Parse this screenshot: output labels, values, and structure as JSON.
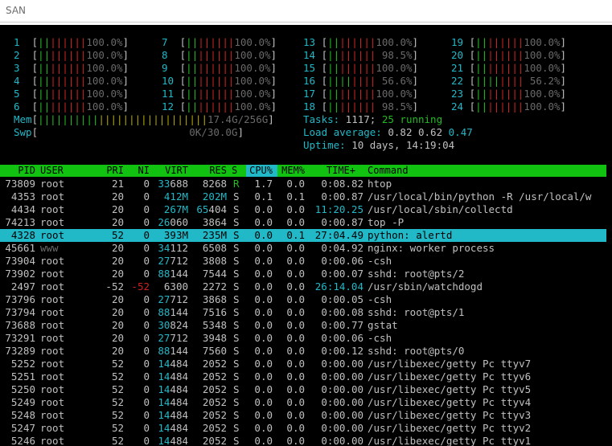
{
  "window": {
    "title": "SAN"
  },
  "cpus": [
    {
      "n": "1",
      "bars": "||||||||",
      "pct": "100.0%"
    },
    {
      "n": "2",
      "bars": "||||||||",
      "pct": "100.0%"
    },
    {
      "n": "3",
      "bars": "||||||||",
      "pct": "100.0%"
    },
    {
      "n": "4",
      "bars": "||||||||",
      "pct": "100.0%"
    },
    {
      "n": "5",
      "bars": "||||||||",
      "pct": "100.0%"
    },
    {
      "n": "6",
      "bars": "||||||||",
      "pct": "100.0%"
    },
    {
      "n": "7",
      "bars": "||||||||",
      "pct": "100.0%"
    },
    {
      "n": "8",
      "bars": "||||||||",
      "pct": "100.0%"
    },
    {
      "n": "9",
      "bars": "||||||||",
      "pct": "100.0%"
    },
    {
      "n": "10",
      "bars": "||||||||",
      "pct": "100.0%"
    },
    {
      "n": "11",
      "bars": "||||||||",
      "pct": "100.0%"
    },
    {
      "n": "12",
      "bars": "||||||||",
      "pct": "100.0%"
    },
    {
      "n": "13",
      "bars": "||||||||",
      "pct": "100.0%"
    },
    {
      "n": "14",
      "bars": "||||||||",
      "pct": "98.5%"
    },
    {
      "n": "15",
      "bars": "||||||||",
      "pct": "100.0%"
    },
    {
      "n": "16",
      "bars": "||||||||",
      "pct": "56.6%"
    },
    {
      "n": "17",
      "bars": "||||||||",
      "pct": "100.0%"
    },
    {
      "n": "18",
      "bars": "||||||||",
      "pct": "98.5%"
    },
    {
      "n": "19",
      "bars": "||||||||",
      "pct": "100.0%"
    },
    {
      "n": "20",
      "bars": "||||||||",
      "pct": "100.0%"
    },
    {
      "n": "21",
      "bars": "||||||||",
      "pct": "100.0%"
    },
    {
      "n": "22",
      "bars": "||||||||",
      "pct": "56.2%"
    },
    {
      "n": "23",
      "bars": "||||||||",
      "pct": "100.0%"
    },
    {
      "n": "24",
      "bars": "||||||||",
      "pct": "100.0%"
    }
  ],
  "mem": {
    "label": "Mem",
    "bars": "||||||||||||||||||||||||||||",
    "value": "17.4G/256G"
  },
  "swp": {
    "label": "Swp",
    "value": "0K/30.0G"
  },
  "tasks": {
    "label": "Tasks:",
    "count": "1117;",
    "running": "25 running"
  },
  "load": {
    "label": "Load average:",
    "one": "0.82",
    "five": "0.62",
    "fifteen": "0.47"
  },
  "uptime": {
    "label": "Uptime:",
    "value": "10 days, 14:19:04"
  },
  "columns": [
    "PID",
    "USER",
    "PRI",
    "NI",
    "VIRT",
    "RES",
    "S",
    "CPU%",
    "MEM%",
    "TIME+",
    "Command"
  ],
  "processes": [
    {
      "pid": "73809",
      "user": "root",
      "pri": "21",
      "ni": "0",
      "virt": "33688",
      "res": "8268",
      "s": "R",
      "cpu": "1.7",
      "mem": "0.0",
      "time": "0:08.82",
      "cmd": "htop"
    },
    {
      "pid": "4353",
      "user": "root",
      "pri": "20",
      "ni": "0",
      "virt": "412M",
      "res": "202M",
      "s": "S",
      "cpu": "0.1",
      "mem": "0.1",
      "time": "0:00.87",
      "cmd": "/usr/local/bin/python -R /usr/local/w"
    },
    {
      "pid": "4434",
      "user": "root",
      "pri": "20",
      "ni": "0",
      "virt": "267M",
      "res": "65404",
      "s": "S",
      "cpu": "0.0",
      "mem": "0.0",
      "time": "11:20.25",
      "cmd": "/usr/local/sbin/collectd"
    },
    {
      "pid": "74213",
      "user": "root",
      "pri": "20",
      "ni": "0",
      "virt": "26060",
      "res": "3864",
      "s": "S",
      "cpu": "0.0",
      "mem": "0.0",
      "time": "0:00.87",
      "cmd": "top -P"
    },
    {
      "pid": "4328",
      "user": "root",
      "pri": "52",
      "ni": "0",
      "virt": "393M",
      "res": "235M",
      "s": "S",
      "cpu": "0.0",
      "mem": "0.1",
      "time": "27:04.49",
      "cmd": "python: alertd"
    },
    {
      "pid": "45661",
      "user": "www",
      "pri": "20",
      "ni": "0",
      "virt": "34112",
      "res": "6508",
      "s": "S",
      "cpu": "0.0",
      "mem": "0.0",
      "time": "0:04.92",
      "cmd": "nginx: worker process"
    },
    {
      "pid": "73904",
      "user": "root",
      "pri": "20",
      "ni": "0",
      "virt": "27712",
      "res": "3808",
      "s": "S",
      "cpu": "0.0",
      "mem": "0.0",
      "time": "0:00.06",
      "cmd": "-csh"
    },
    {
      "pid": "73902",
      "user": "root",
      "pri": "20",
      "ni": "0",
      "virt": "88144",
      "res": "7544",
      "s": "S",
      "cpu": "0.0",
      "mem": "0.0",
      "time": "0:00.07",
      "cmd": "sshd: root@pts/2"
    },
    {
      "pid": "2497",
      "user": "root",
      "pri": "-52",
      "ni": "-52",
      "virt": "6300",
      "res": "2272",
      "s": "S",
      "cpu": "0.0",
      "mem": "0.0",
      "time": "26:14.04",
      "cmd": "/usr/sbin/watchdogd"
    },
    {
      "pid": "73796",
      "user": "root",
      "pri": "20",
      "ni": "0",
      "virt": "27712",
      "res": "3868",
      "s": "S",
      "cpu": "0.0",
      "mem": "0.0",
      "time": "0:00.05",
      "cmd": "-csh"
    },
    {
      "pid": "73794",
      "user": "root",
      "pri": "20",
      "ni": "0",
      "virt": "88144",
      "res": "7516",
      "s": "S",
      "cpu": "0.0",
      "mem": "0.0",
      "time": "0:00.08",
      "cmd": "sshd: root@pts/1"
    },
    {
      "pid": "73688",
      "user": "root",
      "pri": "20",
      "ni": "0",
      "virt": "30824",
      "res": "5348",
      "s": "S",
      "cpu": "0.0",
      "mem": "0.0",
      "time": "0:00.77",
      "cmd": "gstat"
    },
    {
      "pid": "73291",
      "user": "root",
      "pri": "20",
      "ni": "0",
      "virt": "27712",
      "res": "3948",
      "s": "S",
      "cpu": "0.0",
      "mem": "0.0",
      "time": "0:00.06",
      "cmd": "-csh"
    },
    {
      "pid": "73289",
      "user": "root",
      "pri": "20",
      "ni": "0",
      "virt": "88144",
      "res": "7560",
      "s": "S",
      "cpu": "0.0",
      "mem": "0.0",
      "time": "0:00.12",
      "cmd": "sshd: root@pts/0"
    },
    {
      "pid": "5252",
      "user": "root",
      "pri": "52",
      "ni": "0",
      "virt": "14484",
      "res": "2052",
      "s": "S",
      "cpu": "0.0",
      "mem": "0.0",
      "time": "0:00.00",
      "cmd": "/usr/libexec/getty Pc ttyv7"
    },
    {
      "pid": "5251",
      "user": "root",
      "pri": "52",
      "ni": "0",
      "virt": "14484",
      "res": "2052",
      "s": "S",
      "cpu": "0.0",
      "mem": "0.0",
      "time": "0:00.00",
      "cmd": "/usr/libexec/getty Pc ttyv6"
    },
    {
      "pid": "5250",
      "user": "root",
      "pri": "52",
      "ni": "0",
      "virt": "14484",
      "res": "2052",
      "s": "S",
      "cpu": "0.0",
      "mem": "0.0",
      "time": "0:00.00",
      "cmd": "/usr/libexec/getty Pc ttyv5"
    },
    {
      "pid": "5249",
      "user": "root",
      "pri": "52",
      "ni": "0",
      "virt": "14484",
      "res": "2052",
      "s": "S",
      "cpu": "0.0",
      "mem": "0.0",
      "time": "0:00.00",
      "cmd": "/usr/libexec/getty Pc ttyv4"
    },
    {
      "pid": "5248",
      "user": "root",
      "pri": "52",
      "ni": "0",
      "virt": "14484",
      "res": "2052",
      "s": "S",
      "cpu": "0.0",
      "mem": "0.0",
      "time": "0:00.00",
      "cmd": "/usr/libexec/getty Pc ttyv3"
    },
    {
      "pid": "5247",
      "user": "root",
      "pri": "52",
      "ni": "0",
      "virt": "14484",
      "res": "2052",
      "s": "S",
      "cpu": "0.0",
      "mem": "0.0",
      "time": "0:00.00",
      "cmd": "/usr/libexec/getty Pc ttyv2"
    },
    {
      "pid": "5246",
      "user": "root",
      "pri": "52",
      "ni": "0",
      "virt": "14484",
      "res": "2052",
      "s": "S",
      "cpu": "0.0",
      "mem": "0.0",
      "time": "0:00.00",
      "cmd": "/usr/libexec/getty Pc ttyv1"
    }
  ],
  "selected_pid": "4328",
  "colors": {
    "terminal_bg": "#000000",
    "header_bar": "#11c211",
    "selection": "#21b8c7",
    "cyan": "#21b8c7",
    "bar_red": "#cc2222",
    "bar_green": "#22bb22",
    "bar_yellow": "#b0a800"
  }
}
